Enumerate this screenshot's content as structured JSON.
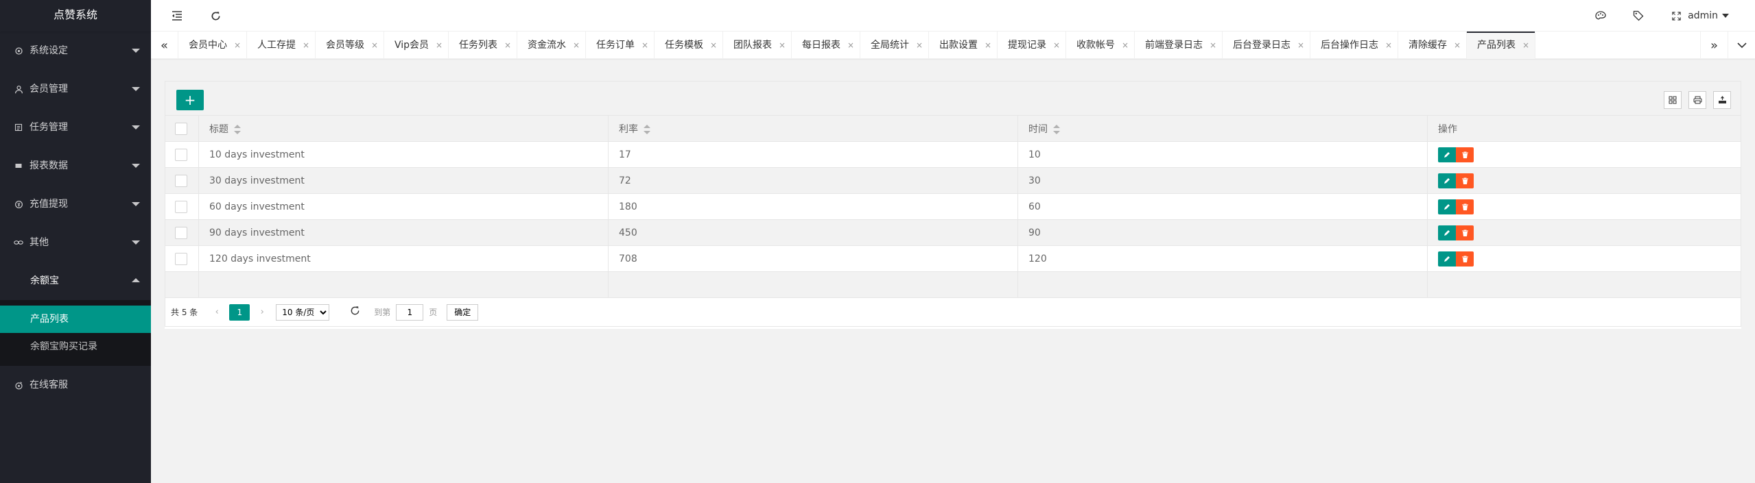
{
  "app": {
    "title": "点赞系统"
  },
  "sidebar": {
    "items": [
      {
        "label": "系统设定",
        "icon": "gear-icon"
      },
      {
        "label": "会员管理",
        "icon": "user-icon"
      },
      {
        "label": "任务管理",
        "icon": "list-icon"
      },
      {
        "label": "报表数据",
        "icon": "chart-icon"
      },
      {
        "label": "充值提现",
        "icon": "wallet-icon"
      },
      {
        "label": "其他",
        "icon": "link-icon"
      },
      {
        "label": "余额宝",
        "icon": "none"
      },
      {
        "label": "在线客服",
        "icon": "support-icon"
      }
    ],
    "sub_items": [
      {
        "label": "产品列表",
        "active": true
      },
      {
        "label": "余额宝购买记录",
        "active": false
      }
    ]
  },
  "header": {
    "user": "admin"
  },
  "tabs": [
    {
      "label": "会员中心"
    },
    {
      "label": "人工存提"
    },
    {
      "label": "会员等级"
    },
    {
      "label": "Vip会员"
    },
    {
      "label": "任务列表"
    },
    {
      "label": "资金流水"
    },
    {
      "label": "任务订单"
    },
    {
      "label": "任务模板"
    },
    {
      "label": "团队报表"
    },
    {
      "label": "每日报表"
    },
    {
      "label": "全局统计"
    },
    {
      "label": "出款设置"
    },
    {
      "label": "提现记录"
    },
    {
      "label": "收款帐号"
    },
    {
      "label": "前端登录日志"
    },
    {
      "label": "后台登录日志"
    },
    {
      "label": "后台操作日志"
    },
    {
      "label": "清除缓存"
    },
    {
      "label": "产品列表",
      "active": true
    }
  ],
  "table": {
    "columns": [
      "标题",
      "利率",
      "时间",
      "操作"
    ],
    "rows": [
      {
        "title": "10 days investment",
        "rate": "17",
        "time": "10"
      },
      {
        "title": "30 days investment",
        "rate": "72",
        "time": "30"
      },
      {
        "title": "60 days investment",
        "rate": "180",
        "time": "60"
      },
      {
        "title": "90 days investment",
        "rate": "450",
        "time": "90"
      },
      {
        "title": "120 days investment",
        "rate": "708",
        "time": "120"
      }
    ]
  },
  "pager": {
    "total": "共 5 条",
    "current": "1",
    "page_size": "10 条/页",
    "goto_label": "到第",
    "goto_value": "1",
    "page_unit": "页",
    "confirm": "确定"
  },
  "colors": {
    "accent": "#009688",
    "danger": "#ff5722",
    "sidebar": "#20222a"
  }
}
